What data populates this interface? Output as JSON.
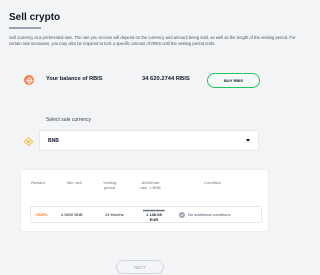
{
  "page": {
    "title": "Sell crypto",
    "intro": "Sell currency at a preferential rate. The rate you receive will depend on the currency and amount being sold, as well as the length of the vesting period. For certain rate increases, you may also be required to lock a specific amount of RBIS until the vesting period ends."
  },
  "balance": {
    "label": "Your balance of RBIS",
    "amount": "34 620.2744 RBIS",
    "buy_label": "BUY RBIS",
    "icon": "rbis-token-icon",
    "icon_color": "#f5834f"
  },
  "currency": {
    "select_label": "Select sale currency",
    "selected": "BNB",
    "icon": "bnb-icon",
    "icon_color": "#f3ba2f"
  },
  "offers": {
    "headers": {
      "reward": "Reward",
      "min_sell": "Min. sell",
      "vesting_1": "Vesting",
      "vesting_2": "period",
      "rate_1": "ArbiSmart",
      "rate_2": "rate, 1 BNB",
      "condition": "Condition"
    },
    "rows": [
      {
        "reward": "+300%",
        "min_sell": "0.5840 BNB",
        "vesting": "24 Months",
        "rate_old": "283.33 EUR",
        "rate_new": "1 136.08",
        "rate_unit": "EUR",
        "condition": "No additional conditions"
      }
    ]
  },
  "actions": {
    "next_label": "NEXT"
  },
  "colors": {
    "accent_green": "#22c55e",
    "reward_orange": "#f97316"
  }
}
